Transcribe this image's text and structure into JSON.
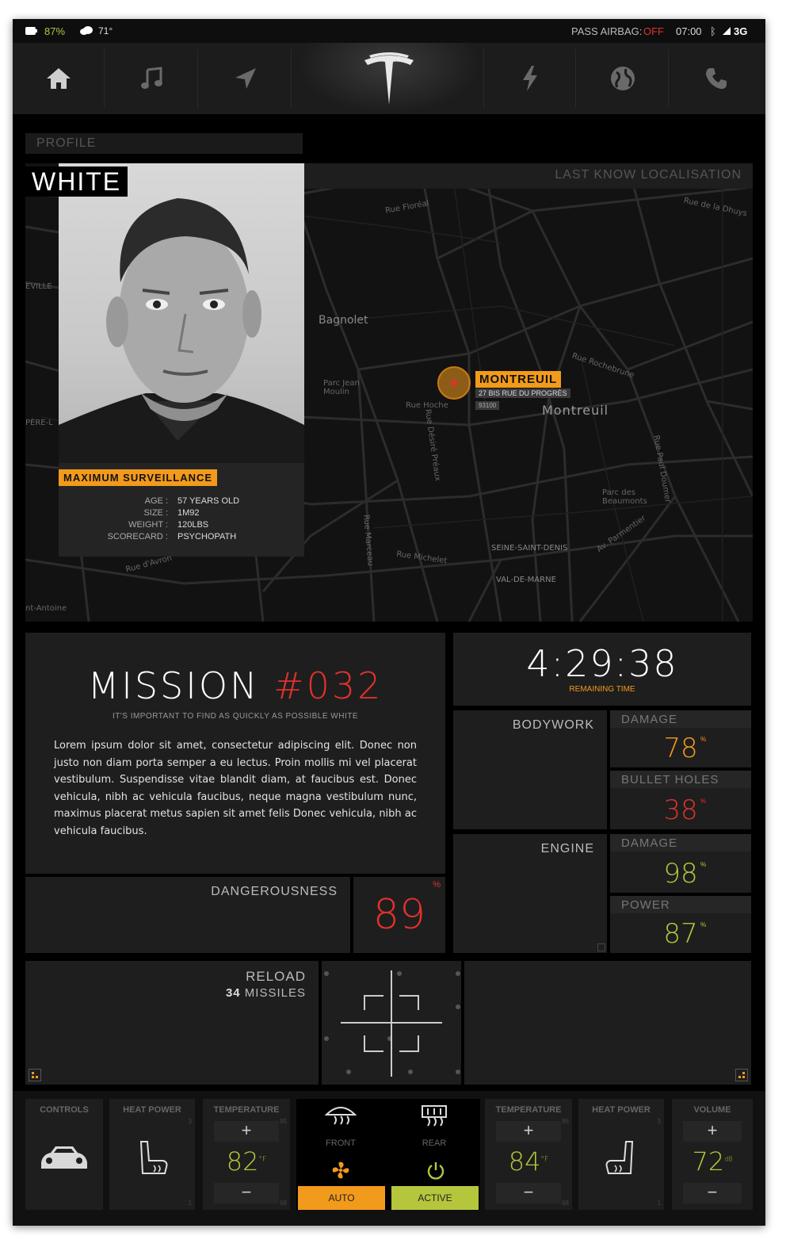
{
  "status": {
    "battery": "87%",
    "weather": "71°",
    "airbag_label": "PASS AIRBAG:",
    "airbag_value": "OFF",
    "time": "07:00",
    "network": "3G"
  },
  "nav": {
    "items": [
      "home-icon",
      "music-icon",
      "navigation-icon",
      "tesla-logo",
      "lightning-icon",
      "globe-icon",
      "phone-icon"
    ]
  },
  "profile": {
    "header": "PROFILE",
    "name": "WHITE",
    "badge": "MAXIMUM SURVEILLANCE",
    "fields": [
      {
        "label": "AGE :",
        "value": "57 YEARS OLD"
      },
      {
        "label": "SIZE :",
        "value": "1M92"
      },
      {
        "label": "WEIGHT :",
        "value": "120LBS"
      },
      {
        "label": "SCORECARD :",
        "value": "PSYCHOPATH"
      }
    ]
  },
  "map": {
    "header": "LAST KNOW LOCALISATION",
    "place": "MONTREUIL",
    "address": "27 BIS RUE DU PROGRÈS",
    "zip": "93100",
    "labels": [
      "Bagnolet",
      "Montreuil",
      "Parc Jean Moulin",
      "Parc des Beaumonts",
      "SEINE-SAINT-DENIS",
      "VAL-DE-MARNE",
      "Rue Hoche",
      "Rue Floréal",
      "Rue Michelet",
      "Rue de la Dhuys",
      "Rue Rochebrune",
      "Rue Marceau",
      "Rue Désiré Préaux",
      "Rue Paul Doumer",
      "Av. Parmentier",
      "Rue d'Avron",
      "EVILLE",
      "PÈRE-L",
      "nt-Antoine"
    ]
  },
  "mission": {
    "title": "MISSION",
    "number": "#032",
    "subtitle": "IT'S IMPORTANT TO FIND AS QUICKLY AS POSSIBLE WHITE",
    "body": "Lorem ipsum dolor sit amet, consectetur adipiscing elit. Donec non justo non diam porta semper a eu lectus. Proin mollis mi vel placerat vestibulum. Suspendisse vitae blandit diam, at faucibus est. Donec vehicula, nibh ac vehicula faucibus, neque magna vestibulum nunc, maximus placerat metus sapien sit amet felis Donec vehicula, nibh ac vehicula faucibus.",
    "danger_label": "DANGEROUSNESS",
    "danger_value": "89",
    "danger_unit": "%"
  },
  "timer": {
    "value": "4:29:38",
    "label": "REMAINING TIME"
  },
  "bodywork": {
    "label": "BODYWORK",
    "damage_label": "DAMAGE",
    "damage_value": "78",
    "holes_label": "BULLET HOLES",
    "holes_value": "38",
    "unit": "%"
  },
  "engine": {
    "label": "ENGINE",
    "damage_label": "DAMAGE",
    "damage_value": "98",
    "power_label": "POWER",
    "power_value": "87",
    "unit": "%"
  },
  "reload": {
    "label": "RELOAD",
    "count": "34",
    "suffix": "MISSILES"
  },
  "controls": {
    "controls_label": "CONTROLS",
    "heat_left_label": "HEAT POWER",
    "heat_left_max": "3",
    "heat_left_min": "1",
    "temp_left_label": "TEMPERATURE",
    "temp_left_value": "82",
    "temp_left_unit": "°F",
    "temp_left_max": "95",
    "temp_left_min": "68",
    "front_label": "FRONT",
    "rear_label": "REAR",
    "auto_label": "AUTO",
    "active_label": "ACTIVE",
    "temp_right_label": "TEMPERATURE",
    "temp_right_value": "84",
    "temp_right_unit": "°F",
    "temp_right_max": "95",
    "temp_right_min": "68",
    "heat_right_label": "HEAT POWER",
    "heat_right_max": "3",
    "heat_right_min": "1",
    "volume_label": "VOLUME",
    "volume_value": "72",
    "volume_unit": "dB",
    "plus": "+",
    "minus": "−"
  },
  "colors": {
    "orange": "#f29a1c",
    "red": "#e0322c",
    "green": "#b5c63c"
  }
}
